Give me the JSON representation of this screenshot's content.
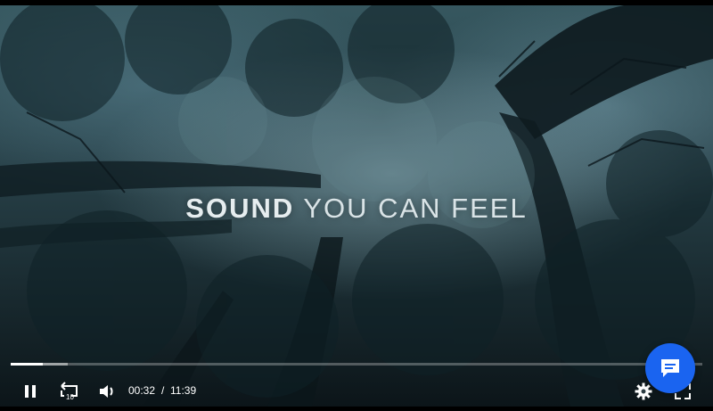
{
  "video": {
    "tagline_strong": "SOUND",
    "tagline_light": "YOU CAN FEEL"
  },
  "player": {
    "current_time": "00:32",
    "separator": "/",
    "duration": "11:39",
    "played_fraction": 0.046,
    "buffered_fraction": 0.083,
    "replay_seconds_label": "10"
  },
  "icons": {
    "play_pause": "pause-icon",
    "rewind": "rewind-10-icon",
    "volume": "volume-icon",
    "settings": "gear-icon",
    "fullscreen": "fullscreen-icon",
    "chat": "chat-bubble-icon"
  },
  "colors": {
    "chat_accent": "#1a64f0",
    "controls": "#ffffff"
  }
}
